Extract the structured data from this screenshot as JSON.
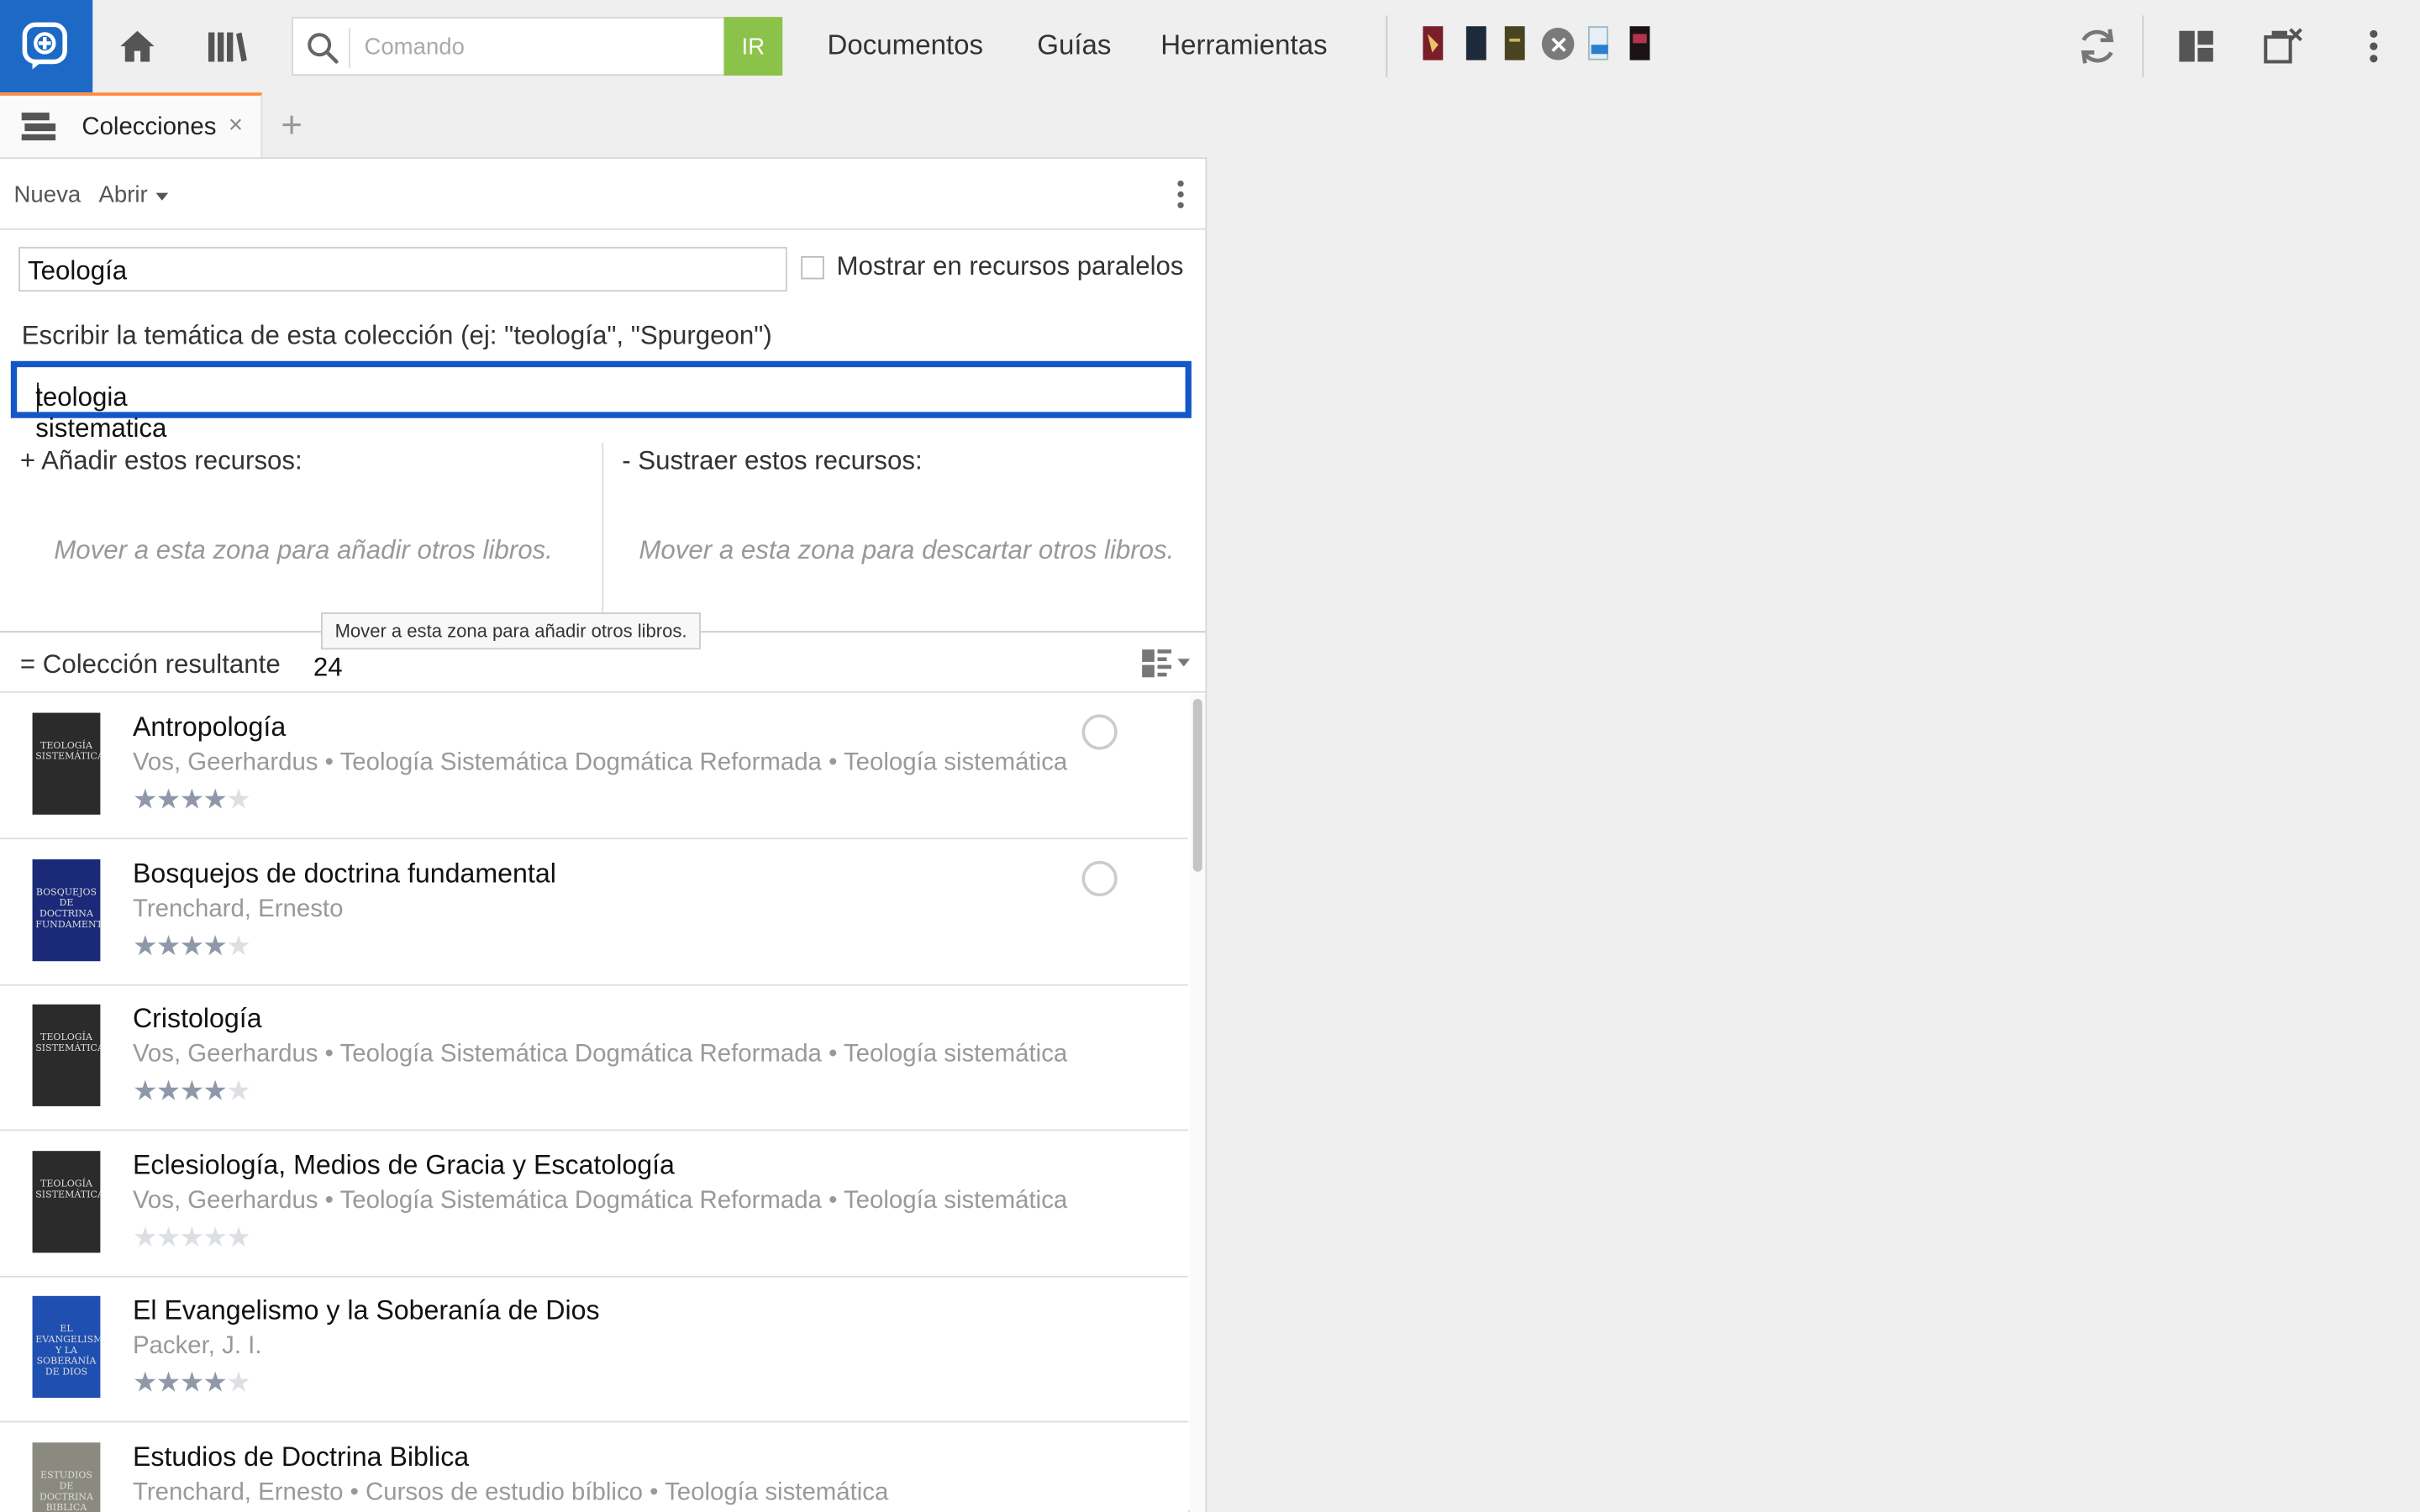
{
  "toolbar": {
    "search_placeholder": "Comando",
    "go_label": "IR",
    "menus": [
      "Documentos",
      "Guías",
      "Herramientas"
    ]
  },
  "tab": {
    "label": "Colecciones",
    "close": "×",
    "add": "+"
  },
  "panel": {
    "new_label": "Nueva",
    "open_label": "Abrir",
    "collection_title": "Teología",
    "parallel_label": "Mostrar en recursos paralelos",
    "topic_prompt": "Escribir la temática de esta colección (ej: \"teología\", \"Spurgeon\")",
    "topic_value": "teologia sistematica",
    "add_label": "+ Añadir estos recursos:",
    "subtract_label": "-  Sustraer estos recursos:",
    "add_hint": "Mover a esta zona para añadir otros libros.",
    "subtract_hint": "Mover a esta zona para descartar otros libros.",
    "tooltip": "Mover a esta zona para añadir otros libros.",
    "result_label": "= Colección resultante",
    "result_count": "24"
  },
  "results": [
    {
      "title": "Antropología",
      "meta": "Vos, Geerhardus • Teología Sistemática Dogmática Reformada • Teología sistemática",
      "rating": 4,
      "cover_text": "TEOLOGÍA SISTEMÁTICA",
      "cover_color": "#2b2b2b"
    },
    {
      "title": "Bosquejos de doctrina fundamental",
      "meta": "Trenchard, Ernesto",
      "rating": 3.5,
      "cover_text": "BOSQUEJOS DE DOCTRINA FUNDAMENTAL",
      "cover_color": "#1a2a78"
    },
    {
      "title": "Cristología",
      "meta": "Vos, Geerhardus • Teología Sistemática Dogmática Reformada • Teología sistemática",
      "rating": 4,
      "cover_text": "TEOLOGÍA SISTEMÁTICA",
      "cover_color": "#2b2b2b"
    },
    {
      "title": "Eclesiología, Medios de Gracia y Escatología",
      "meta": "Vos, Geerhardus • Teología Sistemática Dogmática Reformada • Teología sistemática",
      "rating": 0,
      "cover_text": "TEOLOGÍA SISTEMÁTICA",
      "cover_color": "#2b2b2b"
    },
    {
      "title": "El Evangelismo y la Soberanía de Dios",
      "meta": "Packer, J. I.",
      "rating": 4,
      "cover_text": "EL EVANGELISMO Y LA SOBERANÍA DE DIOS",
      "cover_color": "#1f4fb0"
    },
    {
      "title": "Estudios de Doctrina Biblica",
      "meta": "Trenchard, Ernesto • Cursos de estudio bíblico • Teología sistemática",
      "rating": 0,
      "cover_text": "ESTUDIOS DE DOCTRINA BIBLICA",
      "cover_color": "#8a8a80"
    }
  ],
  "colors": {
    "accent": "#1c69c6",
    "go_button": "#8bc34a",
    "tab_indicator": "#ff8a3d",
    "focus_border": "#1458c7"
  }
}
